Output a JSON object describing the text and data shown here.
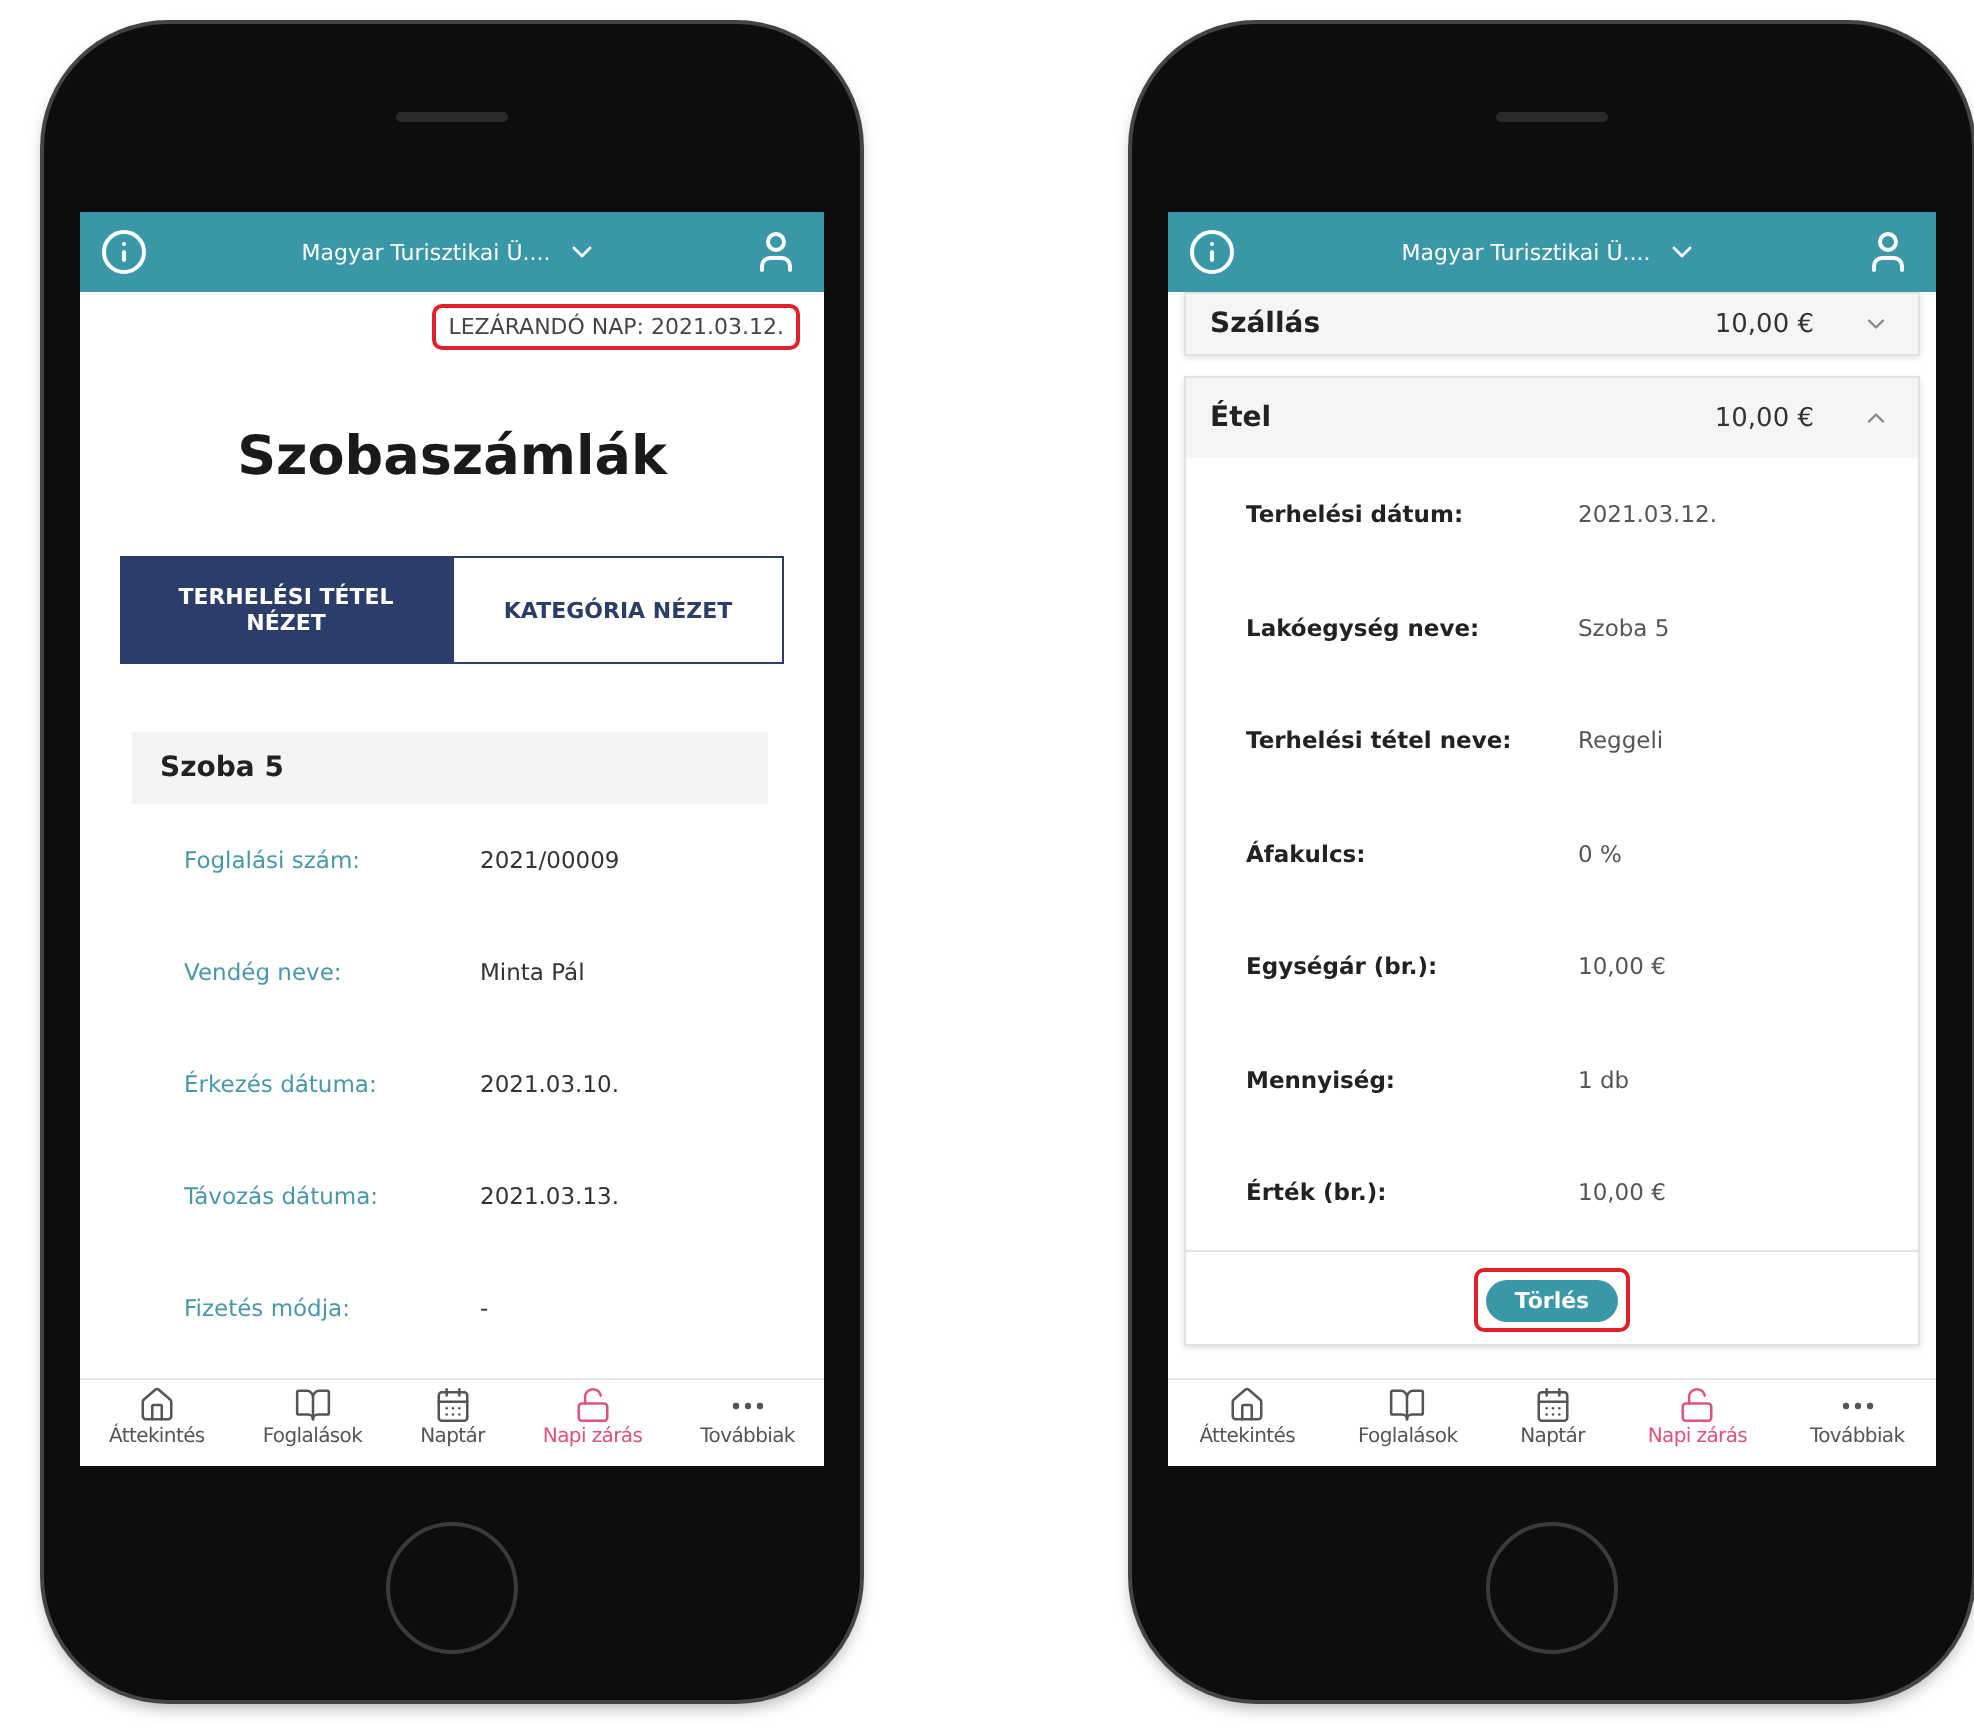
{
  "phones": [
    {
      "kind": "rooms",
      "header": {
        "title": "Magyar Turisztikai Ü...."
      },
      "closing_day": {
        "text": "LEZÁRANDÓ NAP: 2021.03.12.",
        "highlighted": true
      },
      "title": "Szobaszámlák",
      "tabs": [
        {
          "label": "TERHELÉSI TÉTEL NÉZET",
          "selected": true
        },
        {
          "label": "KATEGÓRIA NÉZET",
          "selected": false
        }
      ],
      "room": {
        "name": "Szoba 5",
        "fields": [
          {
            "label": "Foglalási szám:",
            "value": "2021/00009"
          },
          {
            "label": "Vendég neve:",
            "value": "Minta Pál"
          },
          {
            "label": "Érkezés dátuma:",
            "value": "2021.03.10."
          },
          {
            "label": "Távozás dátuma:",
            "value": "2021.03.13."
          },
          {
            "label": "Fizetés módja:",
            "value": "-"
          }
        ]
      },
      "nav": [
        {
          "label": "Áttekintés",
          "selected": false
        },
        {
          "label": "Foglalások",
          "selected": false
        },
        {
          "label": "Naptár",
          "selected": false
        },
        {
          "label": "Napi zárás",
          "selected": true
        },
        {
          "label": "Továbbiak",
          "selected": false
        }
      ]
    },
    {
      "kind": "categories",
      "header": {
        "title": "Magyar Turisztikai Ü...."
      },
      "categories": [
        {
          "name": "Szállás",
          "amount": "10,00 €",
          "expanded": false
        },
        {
          "name": "Étel",
          "amount": "10,00 €",
          "expanded": true,
          "fields": [
            {
              "label": "Terhelési dátum:",
              "value": "2021.03.12."
            },
            {
              "label": "Lakóegység neve:",
              "value": "Szoba 5"
            },
            {
              "label": "Terhelési tétel neve:",
              "value": "Reggeli"
            },
            {
              "label": "Áfakulcs:",
              "value": "0 %"
            },
            {
              "label": "Egységár (br.):",
              "value": "10,00 €"
            },
            {
              "label": "Mennyiség:",
              "value": "1 db"
            },
            {
              "label": "Érték (br.):",
              "value": "10,00 €"
            }
          ],
          "delete_button": {
            "label": "Törlés",
            "highlighted": true
          }
        }
      ],
      "nav": [
        {
          "label": "Áttekintés",
          "selected": false
        },
        {
          "label": "Foglalások",
          "selected": false
        },
        {
          "label": "Naptár",
          "selected": false
        },
        {
          "label": "Napi zárás",
          "selected": true
        },
        {
          "label": "Továbbiak",
          "selected": false
        }
      ]
    }
  ]
}
